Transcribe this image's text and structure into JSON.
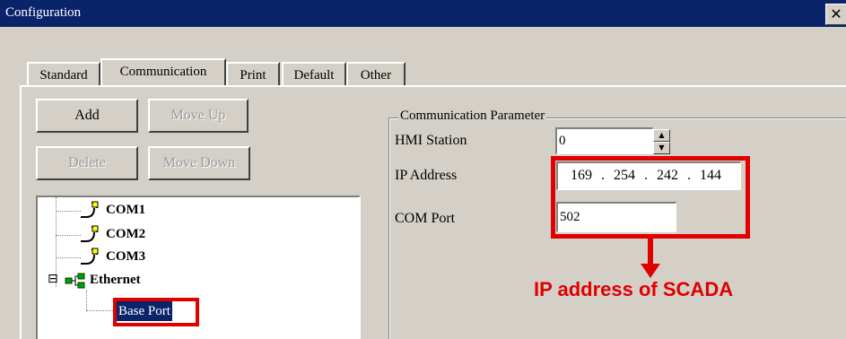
{
  "window": {
    "title": "Configuration",
    "close_glyph": "✕"
  },
  "tabs": [
    {
      "label": "Standard",
      "active": false
    },
    {
      "label": "Communication",
      "active": true
    },
    {
      "label": "Print",
      "active": false
    },
    {
      "label": "Default",
      "active": false
    },
    {
      "label": "Other",
      "active": false
    }
  ],
  "buttons": {
    "add": "Add",
    "move_up": "Move Up",
    "delete": "Delete",
    "move_down": "Move Down"
  },
  "tree": {
    "items": [
      {
        "label": "COM1",
        "icon": "serial-cable-icon"
      },
      {
        "label": "COM2",
        "icon": "serial-cable-icon"
      },
      {
        "label": "COM3",
        "icon": "serial-cable-icon"
      },
      {
        "label": "Ethernet",
        "icon": "network-icon",
        "expander": "⊟"
      }
    ],
    "child": {
      "label": "Base Port",
      "selected": true
    }
  },
  "comm_params": {
    "legend": "Communication Parameter",
    "hmi_station_label": "HMI Station",
    "hmi_station_value": "0",
    "ip_address_label": "IP Address",
    "ip_octets": [
      "169",
      "254",
      "242",
      "144"
    ],
    "ip_separator": ".",
    "com_port_label": "COM Port",
    "com_port_value": "502",
    "spin_up": "▲",
    "spin_down": "▼"
  },
  "annotation": {
    "text": "IP address of SCADA",
    "color": "#e00000"
  },
  "colors": {
    "titlebar": "#0a246a",
    "face": "#d4d0c8",
    "selection": "#0a246a"
  }
}
